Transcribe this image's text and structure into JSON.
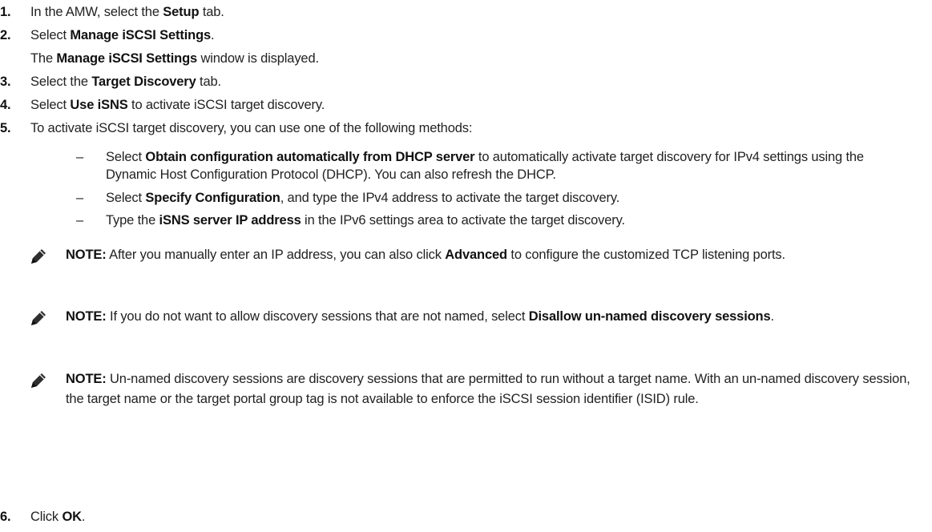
{
  "steps": [
    {
      "num": "1.",
      "pre": "In the AMW, select the ",
      "b1": "Setup",
      "post": " tab."
    },
    {
      "num": "2.",
      "pre": "Select ",
      "b1": "Manage iSCSI Settings",
      "post": ".",
      "sub_pre": "The ",
      "sub_b": "Manage iSCSI Settings",
      "sub_post": " window is displayed."
    },
    {
      "num": "3.",
      "pre": "Select the ",
      "b1": "Target Discovery",
      "post": " tab."
    },
    {
      "num": "4.",
      "pre": "Select ",
      "b1": "Use iSNS",
      "post": " to activate iSCSI target discovery."
    },
    {
      "num": "5.",
      "text": "To activate iSCSI target discovery, you can use one of the following methods:"
    },
    {
      "num": "6.",
      "pre": "Click ",
      "b1": "OK",
      "post": "."
    }
  ],
  "bullets": [
    {
      "dash": "–",
      "pre": "Select ",
      "b": "Obtain configuration automatically from DHCP server",
      "post": " to automatically activate target discovery for IPv4 settings using the Dynamic Host Configuration Protocol (DHCP). You can also refresh the DHCP."
    },
    {
      "dash": "–",
      "pre": "Select ",
      "b": "Specify Configuration",
      "post": ", and type the IPv4 address to activate the target discovery."
    },
    {
      "dash": "–",
      "pre": "Type the ",
      "b": "iSNS server IP address",
      "post": " in the IPv6 settings area to activate the target discovery."
    }
  ],
  "notes": [
    {
      "label": "NOTE:",
      "pre": " After you manually enter an IP address, you can also click ",
      "b": "Advanced",
      "post": " to configure the customized TCP listening ports."
    },
    {
      "label": "NOTE:",
      "pre": " If you do not want to allow discovery sessions that are not named, select ",
      "b": "Disallow un-named discovery sessions",
      "post": "."
    },
    {
      "label": "NOTE:",
      "text": " Un-named discovery sessions are discovery sessions that are permitted to run without a target name. With an un-named discovery session, the target name or the target portal group tag is not available to enforce the iSCSI session identifier (ISID) rule."
    }
  ],
  "icon": {
    "name": "pencil-note-icon",
    "color": "#333333"
  }
}
